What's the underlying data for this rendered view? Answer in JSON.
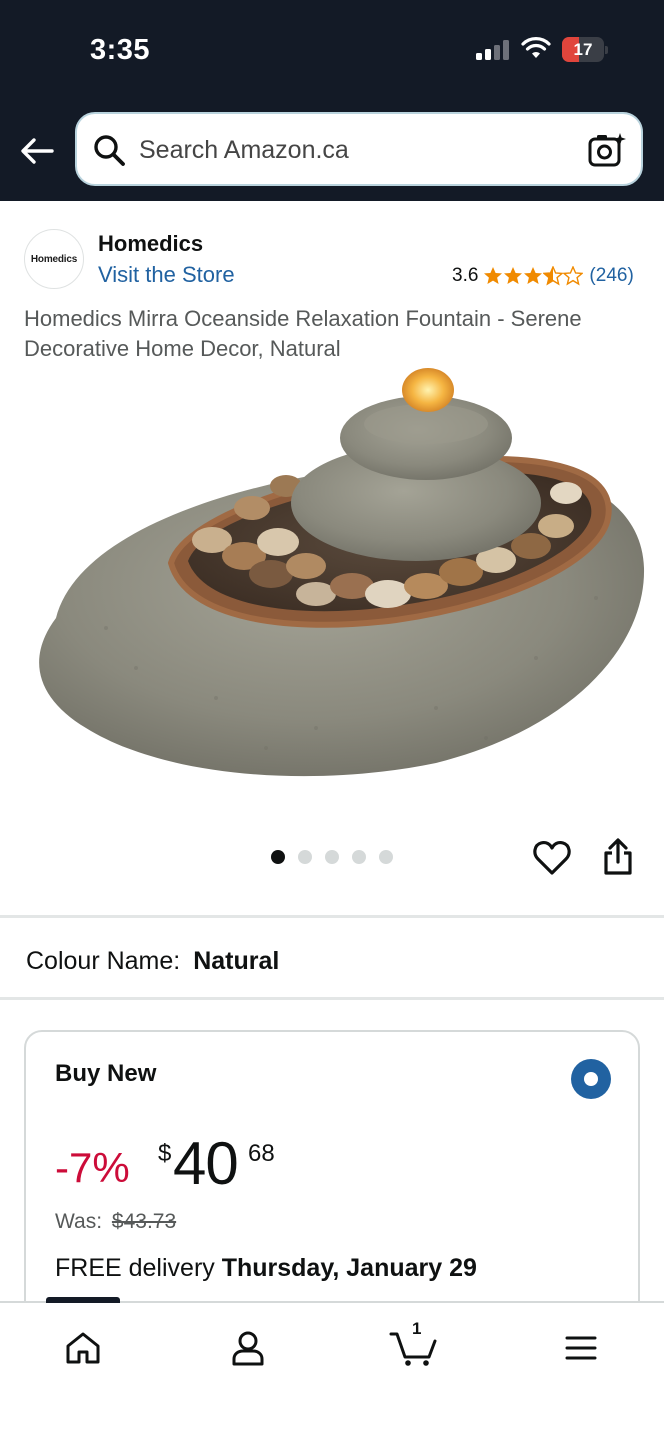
{
  "status_bar": {
    "time": "3:35",
    "battery": "17"
  },
  "search": {
    "placeholder": "Search Amazon.ca"
  },
  "brand": {
    "logo_text": "Homedics",
    "name": "Homedics",
    "visit_store": "Visit the Store"
  },
  "rating": {
    "value": "3.6",
    "stars": 3.6,
    "count": "(246)"
  },
  "product": {
    "title": "Homedics Mirra Oceanside Relaxation Fountain - Serene Decorative Home Decor, Natural",
    "image_count": 5,
    "active_image": 1
  },
  "colour": {
    "label": "Colour Name:",
    "value": "Natural"
  },
  "buy_box": {
    "title": "Buy New",
    "discount": "-7%",
    "currency": "$",
    "price_whole": "40",
    "price_fraction": "68",
    "was_label": "Was:",
    "was_price": "$43.73",
    "delivery_prefix": "FREE delivery",
    "delivery_date": "Thursday, January 29"
  },
  "bottom_nav": {
    "items": [
      "home-icon",
      "account-icon",
      "cart-icon",
      "menu-icon"
    ],
    "cart_count": "1"
  },
  "colors": {
    "header_bg": "#131a26",
    "link": "#2162a1",
    "star": "#f08a00",
    "discount": "#cc0c39",
    "radio": "#2162a1"
  }
}
